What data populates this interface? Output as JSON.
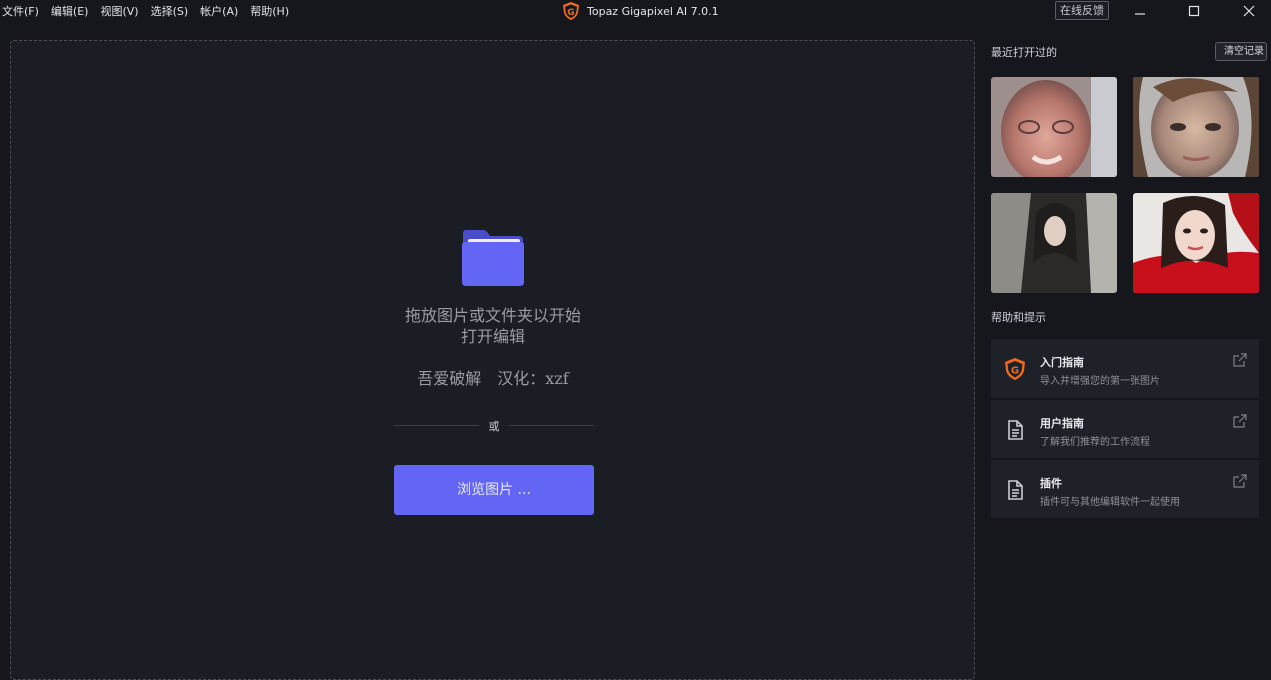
{
  "menu": [
    "文件(F)",
    "编辑(E)",
    "视图(V)",
    "选择(S)",
    "帐户(A)",
    "帮助(H)"
  ],
  "app_title": "Topaz Gigapixel AI 7.0.1",
  "feedback_label": "在线反馈",
  "dropzone": {
    "line1": "拖放图片或文件夹以开始",
    "line2": "打开编辑",
    "credit": "吾爱破解　汉化：xzf",
    "or_label": "或",
    "browse_label": "浏览图片 ..."
  },
  "recent": {
    "title": "最近打开过的",
    "clear_label": "清空记录"
  },
  "help": {
    "title": "帮助和提示",
    "items": [
      {
        "title": "入门指南",
        "subtitle": "导入并增强您的第一张图片",
        "icon": "topaz-logo-icon"
      },
      {
        "title": "用户指南",
        "subtitle": "了解我们推荐的工作流程",
        "icon": "document-icon"
      },
      {
        "title": "插件",
        "subtitle": "插件可与其他编辑软件一起使用",
        "icon": "document-icon"
      }
    ]
  },
  "colors": {
    "accent": "#6366f4",
    "logo_orange": "#f26a1b",
    "background": "#15171d",
    "dropzone_bg": "#1b1d25"
  }
}
